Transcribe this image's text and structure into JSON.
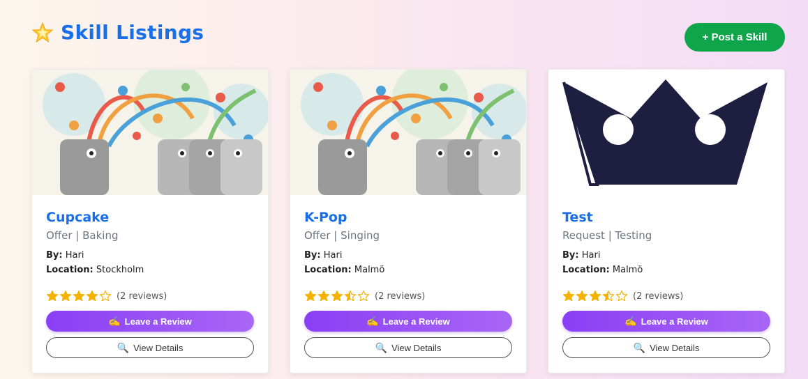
{
  "header": {
    "title": "Skill Listings",
    "icon": "star-icon",
    "post_button_label": "+ Post a Skill"
  },
  "colors": {
    "title": "#1a6fe8",
    "post_button": "#0fa64b",
    "review_button": "#8a3ff5",
    "star": "#f5b301"
  },
  "listings": [
    {
      "title": "Cupcake",
      "subtitle": "Offer | Baking",
      "by_label": "By:",
      "by": "Hari",
      "location_label": "Location:",
      "location": "Stockholm",
      "rating": 4,
      "reviews": "(2 reviews)",
      "image": "learning-illustration",
      "review_button": "Leave a Review",
      "review_icon": "✍️",
      "details_button": "View Details",
      "details_icon": "🔍"
    },
    {
      "title": "K-Pop",
      "subtitle": "Offer | Singing",
      "by_label": "By:",
      "by": "Hari",
      "location_label": "Location:",
      "location": "Malmö",
      "rating": 3.5,
      "reviews": "(2 reviews)",
      "image": "learning-illustration",
      "review_button": "Leave a Review",
      "review_icon": "✍️",
      "details_button": "View Details",
      "details_icon": "🔍"
    },
    {
      "title": "Test",
      "subtitle": "Request | Testing",
      "by_label": "By:",
      "by": "Hari",
      "location_label": "Location:",
      "location": "Malmö",
      "rating": 3.5,
      "reviews": "(2 reviews)",
      "image": "crown-logo",
      "review_button": "Leave a Review",
      "review_icon": "✍️",
      "details_button": "View Details",
      "details_icon": "🔍"
    }
  ]
}
